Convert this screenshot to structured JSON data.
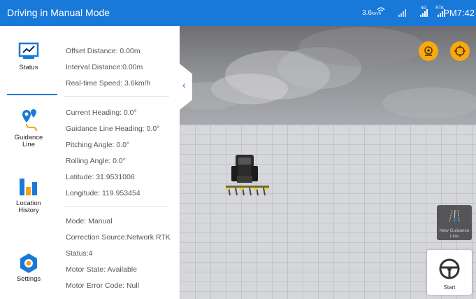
{
  "topbar": {
    "title": "Driving in Manual Mode",
    "speed_value": "3.6",
    "speed_unit": "km/h",
    "sig_4g_tag": "4G",
    "sig_rtk_tag": "RTK",
    "time": "PM7:42"
  },
  "nav": {
    "items": [
      {
        "label": "Status",
        "icon": "status-chart-icon"
      },
      {
        "label": "Guidance Line",
        "icon": "guidance-line-icon"
      },
      {
        "label": "Location History",
        "icon": "location-history-icon"
      },
      {
        "label": "Settings",
        "icon": "settings-gear-icon"
      }
    ]
  },
  "panel": {
    "offset_distance": "Offset Distance: 0.00m",
    "interval_distance": "Interval Distance:0.00m",
    "realtime_speed": "Real-time Speed: 3.6km/h",
    "current_heading": "Current Heading: 0.0°",
    "guidance_line_heading": "Guidance Line Heading: 0.0°",
    "pitching_angle": "Pitching Angle: 0.0°",
    "rolling_angle": "Rolling Angle: 0.0°",
    "latitude": "Latitude: 31.9531006",
    "longitude": "Longitude: 119.953454",
    "mode": "Mode: Manual",
    "correction_source": "Correction Source:Network RTK",
    "status": "Status:4",
    "motor_state": "Motor State: Available",
    "motor_error_code": "Motor Error Code: Null"
  },
  "scene": {
    "new_guidance_line_label": "New Guidance Line",
    "start_label": "Start"
  },
  "colors": {
    "primary": "#1879d9",
    "accent_orange": "#f7a90f",
    "guidance_orange": "#f4a216",
    "nav_icon_blue": "#1879d9"
  }
}
